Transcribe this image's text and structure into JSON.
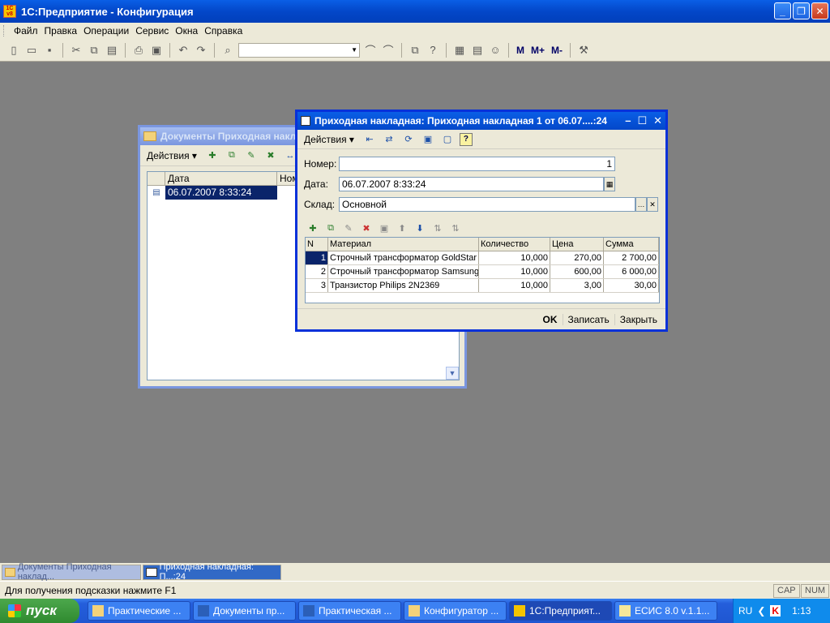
{
  "app": {
    "logo_text": "1C v8",
    "title": "1С:Предприятие - Конфигурация"
  },
  "window_buttons": [
    "_",
    "❐",
    "✕"
  ],
  "menu": [
    "Файл",
    "Правка",
    "Операции",
    "Сервис",
    "Окна",
    "Справка"
  ],
  "toolbar": {
    "combo_value": "",
    "buttons": [
      "new-icon",
      "open-icon",
      "save-icon",
      "cut-icon",
      "copy-icon",
      "paste-icon",
      "print-icon",
      "preview-icon",
      "undo-icon",
      "redo-icon",
      "find-icon"
    ],
    "m_buttons": [
      "M",
      "M+",
      "M-"
    ]
  },
  "list_window": {
    "title": "Документы Приходная накладная",
    "actions_label": "Действия",
    "columns": [
      "Дата",
      "Номер"
    ],
    "rows": [
      {
        "date": "06.07.2007 8:33:24"
      }
    ]
  },
  "doc_window": {
    "title": "Приходная накладная: Приходная накладная 1 от 06.07....:24",
    "actions_label": "Действия",
    "help_label": "?",
    "fields": {
      "number_label": "Номер:",
      "number_value": "1",
      "date_label": "Дата:",
      "date_value": "06.07.2007  8:33:24",
      "warehouse_label": "Склад:",
      "warehouse_value": "Основной"
    },
    "table": {
      "columns": [
        "N",
        "Материал",
        "Количество",
        "Цена",
        "Сумма"
      ],
      "rows": [
        {
          "n": "1",
          "material": "Строчный трансформатор GoldStar",
          "qty": "10,000",
          "price": "270,00",
          "sum": "2 700,00"
        },
        {
          "n": "2",
          "material": "Строчный трансформатор Samsung",
          "qty": "10,000",
          "price": "600,00",
          "sum": "6 000,00"
        },
        {
          "n": "3",
          "material": "Транзистор Philips 2N2369",
          "qty": "10,000",
          "price": "3,00",
          "sum": "30,00"
        }
      ]
    },
    "footer": {
      "ok": "OK",
      "save": "Записать",
      "close": "Закрыть"
    }
  },
  "window_tabs": [
    {
      "label": "Документы Приходная наклад...",
      "active": false
    },
    {
      "label": "Приходная накладная: П...:24",
      "active": true
    }
  ],
  "status": {
    "hint": "Для получения подсказки нажмите F1",
    "cap": "CAP",
    "num": "NUM"
  },
  "taskbar": {
    "start_label": "пуск",
    "tasks": [
      "Практические ...",
      "Документы пр...",
      "Практическая ...",
      "Конфигуратор ...",
      "1С:Предприят...",
      "ЕСИС 8.0 v.1.1..."
    ],
    "lang": "RU",
    "clock": "1:13"
  }
}
